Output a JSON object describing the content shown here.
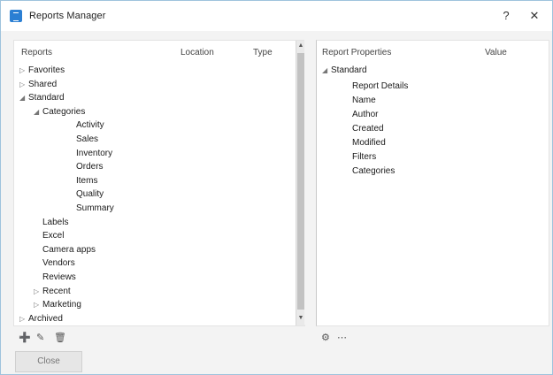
{
  "window": {
    "title": "Reports Manager"
  },
  "titlebar": {
    "help_label": "?",
    "close_label": "✕"
  },
  "left": {
    "headers": {
      "name": "Reports",
      "location": "Location",
      "type": "Type"
    },
    "tree": [
      {
        "label": "Favorites",
        "depth": 1,
        "expander": "▷"
      },
      {
        "label": "Shared",
        "depth": 1,
        "expander": "▷"
      },
      {
        "label": "Standard",
        "depth": 1,
        "expander": "◢"
      },
      {
        "label": "Categories",
        "depth": 2,
        "expander": "◢"
      },
      {
        "label": "Activity",
        "depth": 4,
        "expander": ""
      },
      {
        "label": "Sales",
        "depth": 4,
        "expander": ""
      },
      {
        "label": "Inventory",
        "depth": 4,
        "expander": ""
      },
      {
        "label": "Orders",
        "depth": 4,
        "expander": ""
      },
      {
        "label": "Items",
        "depth": 4,
        "expander": ""
      },
      {
        "label": "Quality",
        "depth": 4,
        "expander": ""
      },
      {
        "label": "Summary",
        "depth": 4,
        "expander": ""
      },
      {
        "label": "Labels",
        "depth": 2,
        "expander": ""
      },
      {
        "label": "Excel",
        "depth": 2,
        "expander": ""
      },
      {
        "label": "Camera apps",
        "depth": 2,
        "expander": ""
      },
      {
        "label": "Vendors",
        "depth": 2,
        "expander": ""
      },
      {
        "label": "Reviews",
        "depth": 2,
        "expander": ""
      },
      {
        "label": "Recent",
        "depth": 2,
        "expander": "▷"
      },
      {
        "label": "Marketing",
        "depth": 2,
        "expander": "▷"
      },
      {
        "label": "Archived",
        "depth": 1,
        "expander": "▷"
      }
    ]
  },
  "right": {
    "headers": {
      "name": "Report Properties",
      "value": "Value"
    },
    "root": "Standard",
    "items": [
      "Report Details",
      "Name",
      "Author",
      "Created",
      "Modified",
      "Filters",
      "Categories"
    ]
  },
  "toolbar": {
    "left": [
      "➕",
      "✎",
      "🗑"
    ],
    "right": [
      "⚙",
      "⋯"
    ]
  },
  "footer": {
    "button_label": "Close"
  }
}
